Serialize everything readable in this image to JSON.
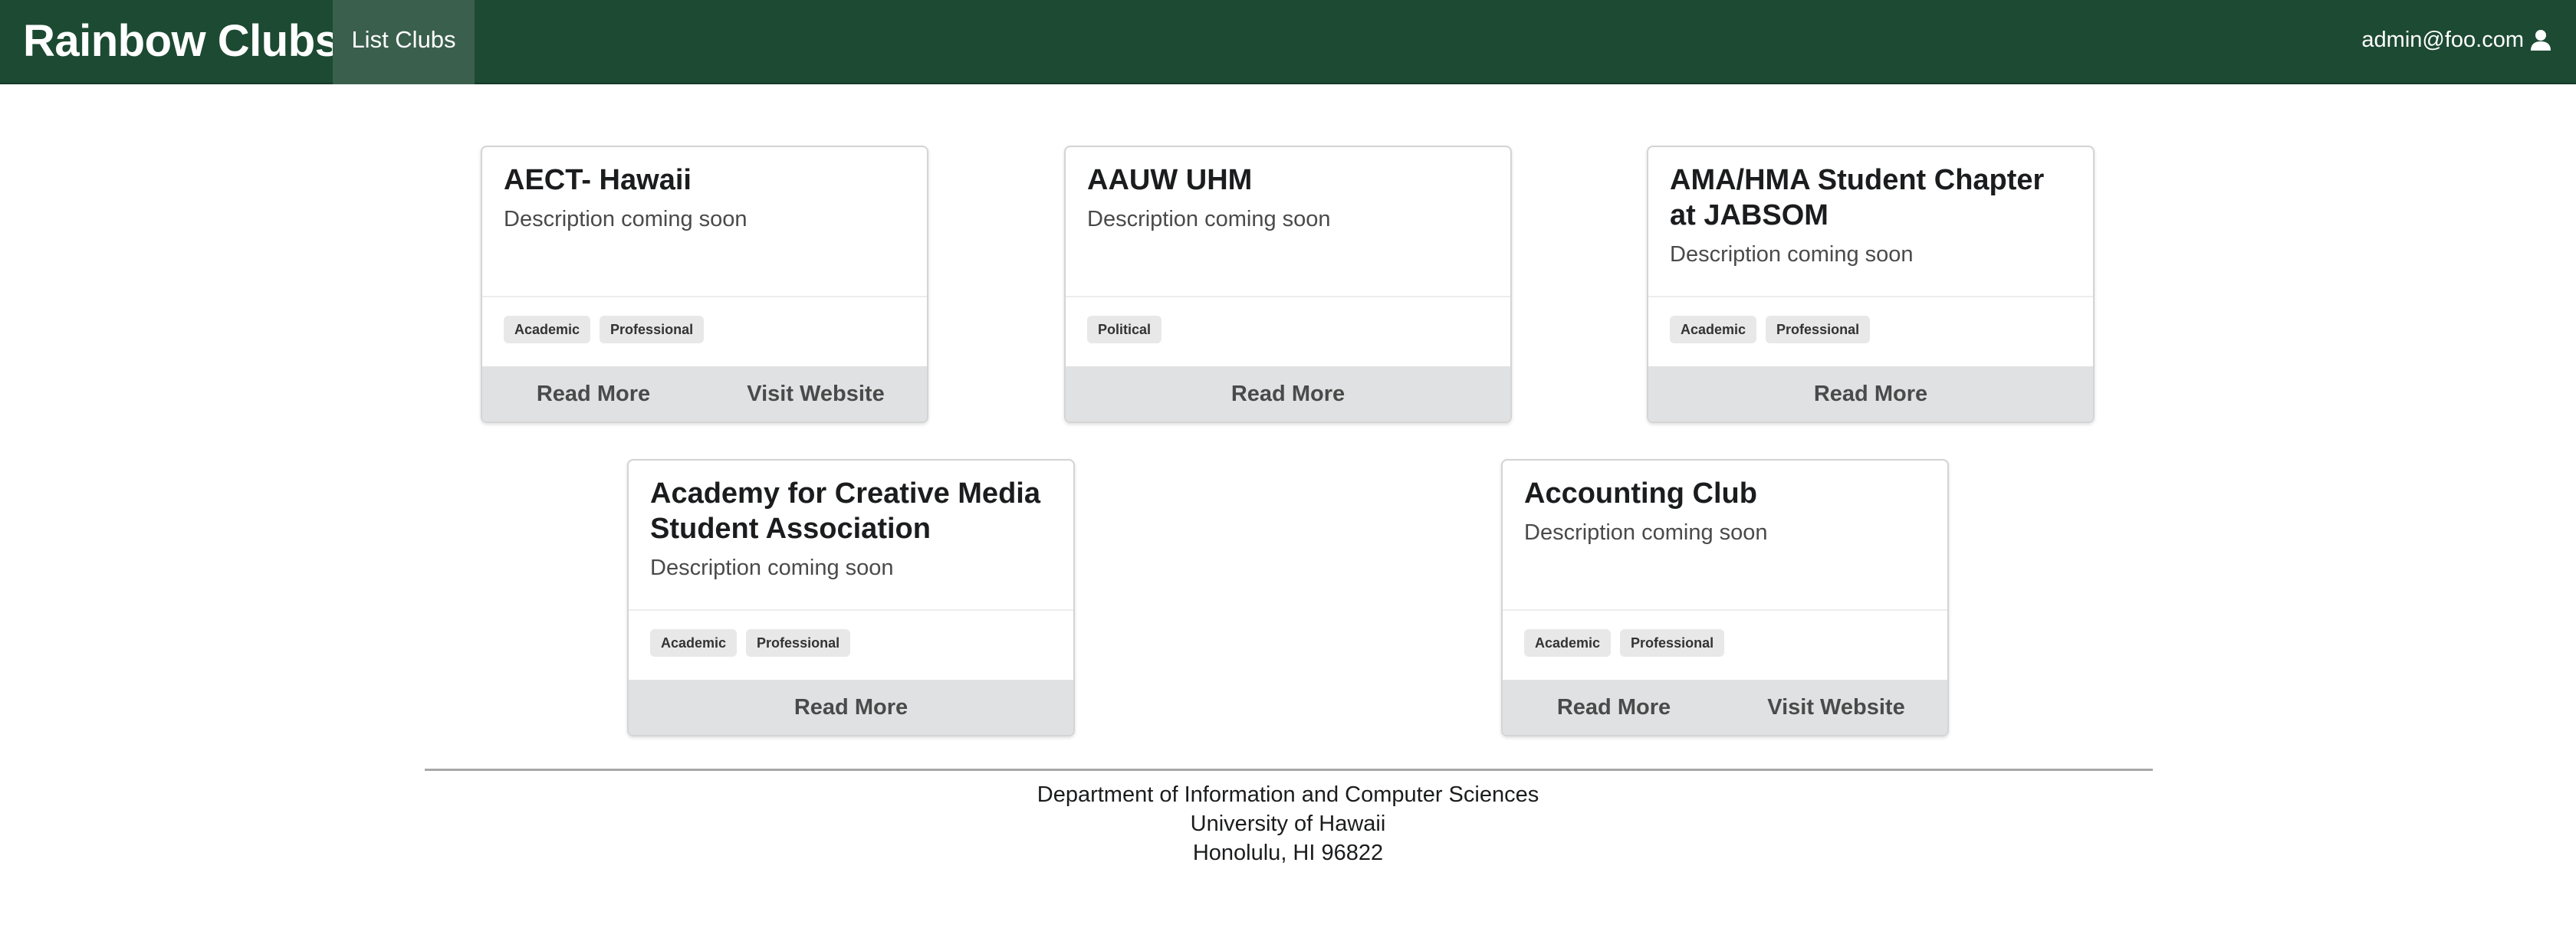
{
  "navbar": {
    "brand": "Rainbow Clubs",
    "nav_item": "List Clubs",
    "user_email": "admin@foo.com"
  },
  "clubs": [
    {
      "name": "AECT- Hawaii",
      "description": "Description coming soon",
      "tags": [
        "Academic",
        "Professional"
      ],
      "buttons": [
        "Read More",
        "Visit Website"
      ]
    },
    {
      "name": "AAUW UHM",
      "description": "Description coming soon",
      "tags": [
        "Political"
      ],
      "buttons": [
        "Read More"
      ]
    },
    {
      "name": "AMA/HMA Student Chapter at JABSOM",
      "description": "Description coming soon",
      "tags": [
        "Academic",
        "Professional"
      ],
      "buttons": [
        "Read More"
      ]
    },
    {
      "name": "Academy for Creative Media Student Association",
      "description": "Description coming soon",
      "tags": [
        "Academic",
        "Professional"
      ],
      "buttons": [
        "Read More"
      ]
    },
    {
      "name": "Accounting Club",
      "description": "Description coming soon",
      "tags": [
        "Academic",
        "Professional"
      ],
      "buttons": [
        "Read More",
        "Visit Website"
      ]
    }
  ],
  "footer": {
    "line1": "Department of Information and Computer Sciences",
    "line2": "University of Hawaii",
    "line3": "Honolulu, HI 96822"
  },
  "colors": {
    "navbar_bg": "#1d4a32",
    "active_nav_bg": "#3a5f4d",
    "button_bg": "#e0e1e2",
    "tag_bg": "#e8e8e8"
  },
  "icons": {
    "user_menu": "user-icon"
  }
}
